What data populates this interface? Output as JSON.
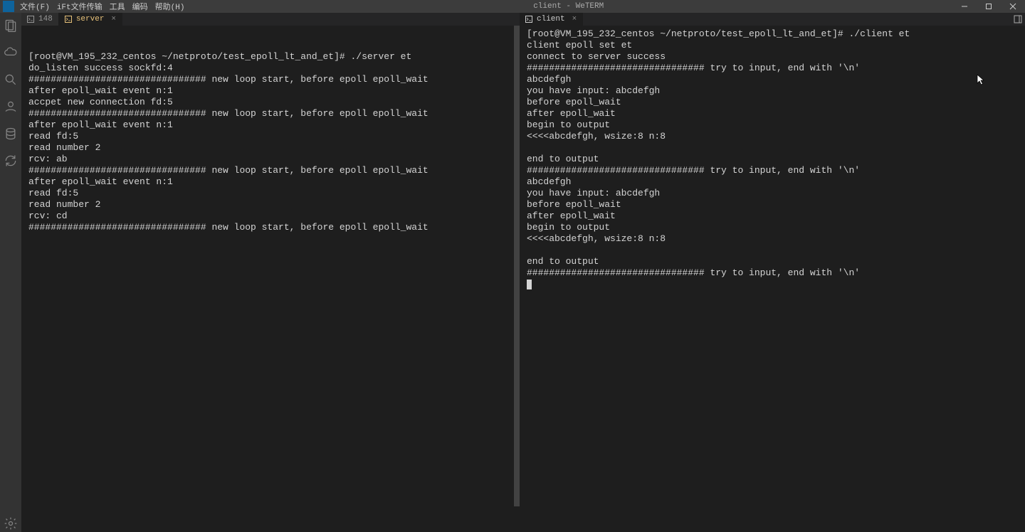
{
  "titlebar": {
    "menu": [
      "文件(F)",
      "iFt文件传输",
      "工具",
      "编码",
      "帮助(H)"
    ],
    "title": "client - WeTERM"
  },
  "activitybar": {
    "items": [
      "files",
      "cloud",
      "search",
      "person",
      "database",
      "refresh"
    ],
    "bottom": "settings"
  },
  "panes": {
    "left": {
      "tabs": [
        {
          "label": "148",
          "active": false
        },
        {
          "label": "server",
          "active": true
        }
      ],
      "lines": [
        "[root@VM_195_232_centos ~/netproto/test_epoll_lt_and_et]# ./server et",
        "do_listen success sockfd:4",
        "################################ new loop start, before epoll epoll_wait",
        "after epoll_wait event n:1",
        "accpet new connection fd:5",
        "################################ new loop start, before epoll epoll_wait",
        "after epoll_wait event n:1",
        "read fd:5",
        "read number 2",
        "rcv: ab",
        "################################ new loop start, before epoll epoll_wait",
        "after epoll_wait event n:1",
        "read fd:5",
        "read number 2",
        "rcv: cd",
        "################################ new loop start, before epoll epoll_wait"
      ]
    },
    "right": {
      "tabs": [
        {
          "label": "client",
          "active": true
        }
      ],
      "lines": [
        "[root@VM_195_232_centos ~/netproto/test_epoll_lt_and_et]# ./client et",
        "client epoll set et",
        "connect to server success",
        "################################ try to input, end with '\\n'",
        "abcdefgh",
        "you have input: abcdefgh",
        "before epoll_wait",
        "after epoll_wait",
        "begin to output",
        "<<<<abcdefgh, wsize:8 n:8",
        "",
        "end to output",
        "################################ try to input, end with '\\n'",
        "abcdefgh",
        "you have input: abcdefgh",
        "before epoll_wait",
        "after epoll_wait",
        "begin to output",
        "<<<<abcdefgh, wsize:8 n:8",
        "",
        "end to output",
        "################################ try to input, end with '\\n'"
      ]
    }
  }
}
